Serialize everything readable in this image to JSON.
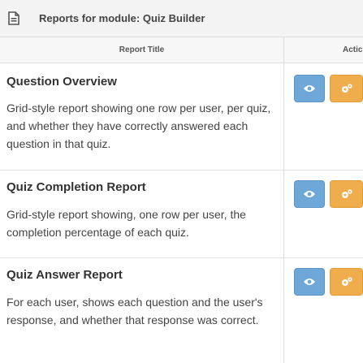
{
  "header": {
    "title": "Reports for module: Quiz Builder",
    "icon": "document-icon"
  },
  "table": {
    "columns": [
      "Report Title",
      "Actic"
    ],
    "rows": [
      {
        "title": "Question Overview",
        "description": "Grid-style report showing one row per user, per quiz, and whether they have correctly answered each question in that quiz."
      },
      {
        "title": "Quiz Completion Report",
        "description": "Grid-style report showing, one row per user, the completion percentage of each quiz."
      },
      {
        "title": "Quiz Answer Report",
        "description": "For each user, shows each question and the user's response, and whether that response was correct."
      }
    ],
    "actions": {
      "view_icon": "eye-icon",
      "settings_icon": "cogs-icon"
    }
  },
  "colors": {
    "view_button": "#6ea8d8",
    "settings_button": "#f0ad4e",
    "header_bg": "#f3f3f3"
  }
}
